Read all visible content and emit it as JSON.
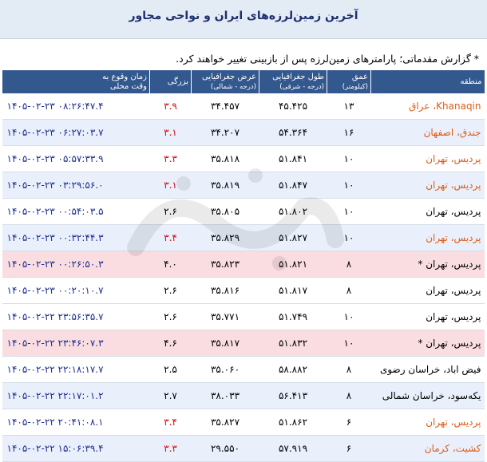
{
  "header": {
    "title": "آخرین زمین‌لرزه‌های ایران و نواحی مجاور"
  },
  "note": "* گزارش مقدماتی؛ پارامترهای زمین‌لرزه پس از بازبینی تغییر خواهند کرد.",
  "columns": {
    "region": "منطقه",
    "depth": [
      "عمق",
      "(کیلومتر)"
    ],
    "lon": [
      "طول جغرافیایی",
      "(درجه - شرقی)"
    ],
    "lat": [
      "عرض جغرافیایی",
      "(درجه - شمالی)"
    ],
    "mag": "بزرگی",
    "time": [
      "زمان وقوع به",
      "وقت محلی"
    ]
  },
  "rows": [
    {
      "region": "Khanaqin، عراق",
      "depth": "۱۳",
      "lon": "۴۵.۴۲۵",
      "lat": "۳۴.۴۵۷",
      "mag": "۳.۹",
      "time": "۱۴۰۵-۰۲-۲۳ ۰۸:۲۶:۴۷.۴",
      "style": "odd",
      "highlight": true
    },
    {
      "region": "جندق، اصفهان",
      "depth": "۱۶",
      "lon": "۵۴.۳۶۴",
      "lat": "۳۴.۲۰۷",
      "mag": "۳.۱",
      "time": "۱۴۰۵-۰۲-۲۳ ۰۶:۲۷:۰۳.۷",
      "style": "even",
      "highlight": true
    },
    {
      "region": "پردیس، تهران",
      "depth": "۱۰",
      "lon": "۵۱.۸۴۱",
      "lat": "۳۵.۸۱۸",
      "mag": "۳.۳",
      "time": "۱۴۰۵-۰۲-۲۳ ۰۵:۵۷:۳۳.۹",
      "style": "odd",
      "highlight": true
    },
    {
      "region": "پردیس، تهران",
      "depth": "۱۰",
      "lon": "۵۱.۸۴۷",
      "lat": "۳۵.۸۱۹",
      "mag": "۳.۱",
      "time": "۱۴۰۵-۰۲-۲۳ ۰۳:۲۹:۵۶.۰",
      "style": "even",
      "highlight": true
    },
    {
      "region": "پردیس، تهران",
      "depth": "۱۰",
      "lon": "۵۱.۸۰۲",
      "lat": "۳۵.۸۰۵",
      "mag": "۲.۶",
      "time": "۱۴۰۵-۰۲-۲۳ ۰۰:۵۴:۰۳.۵",
      "style": "odd",
      "highlight": false
    },
    {
      "region": "پردیس، تهران",
      "depth": "۱۰",
      "lon": "۵۱.۸۲۷",
      "lat": "۳۵.۸۲۹",
      "mag": "۳.۴",
      "time": "۱۴۰۵-۰۲-۲۳ ۰۰:۳۲:۴۴.۳",
      "style": "even",
      "highlight": true
    },
    {
      "region": "پردیس، تهران *",
      "depth": "۸",
      "lon": "۵۱.۸۲۱",
      "lat": "۳۵.۸۲۳",
      "mag": "۴.۰",
      "time": "۱۴۰۵-۰۲-۲۳ ۰۰:۲۶:۵۰.۳",
      "style": "strong",
      "highlight": false
    },
    {
      "region": "پردیس، تهران",
      "depth": "۸",
      "lon": "۵۱.۸۱۷",
      "lat": "۳۵.۸۱۶",
      "mag": "۲.۶",
      "time": "۱۴۰۵-۰۲-۲۳ ۰۰:۲۰:۱۰.۷",
      "style": "odd",
      "highlight": false
    },
    {
      "region": "پردیس، تهران",
      "depth": "۱۰",
      "lon": "۵۱.۷۴۹",
      "lat": "۳۵.۷۷۱",
      "mag": "۲.۶",
      "time": "۱۴۰۵-۰۲-۲۲ ۲۳:۵۶:۳۵.۷",
      "style": "odd",
      "highlight": false
    },
    {
      "region": "پردیس، تهران *",
      "depth": "۱۰",
      "lon": "۵۱.۸۳۲",
      "lat": "۳۵.۸۱۷",
      "mag": "۴.۶",
      "time": "۱۴۰۵-۰۲-۲۲ ۲۳:۴۶:۰۷.۳",
      "style": "strong",
      "highlight": false
    },
    {
      "region": "فیض اباد، خراسان رضوی",
      "depth": "۸",
      "lon": "۵۸.۸۸۲",
      "lat": "۳۵.۰۶۰",
      "mag": "۲.۵",
      "time": "۱۴۰۵-۰۲-۲۲ ۲۲:۱۸:۱۷.۷",
      "style": "odd",
      "highlight": false
    },
    {
      "region": "یکه‌سود، خراسان شمالی",
      "depth": "۸",
      "lon": "۵۶.۴۱۳",
      "lat": "۳۸.۰۳۳",
      "mag": "۲.۷",
      "time": "۱۴۰۵-۰۲-۲۲ ۲۲:۱۷:۰۱.۲",
      "style": "even",
      "highlight": false
    },
    {
      "region": "پردیس، تهران",
      "depth": "۶",
      "lon": "۵۱.۸۶۲",
      "lat": "۳۵.۸۲۷",
      "mag": "۳.۴",
      "time": "۱۴۰۵-۰۲-۲۲ ۲۰:۴۱:۰۸.۱",
      "style": "odd",
      "highlight": true
    },
    {
      "region": "کشیت، کرمان",
      "depth": "۶",
      "lon": "۵۷.۹۱۹",
      "lat": "۲۹.۵۵۰",
      "mag": "۳.۳",
      "time": "۱۴۰۵-۰۲-۲۲ ۱۵:۰۶:۳۹.۴",
      "style": "even",
      "highlight": true
    }
  ]
}
